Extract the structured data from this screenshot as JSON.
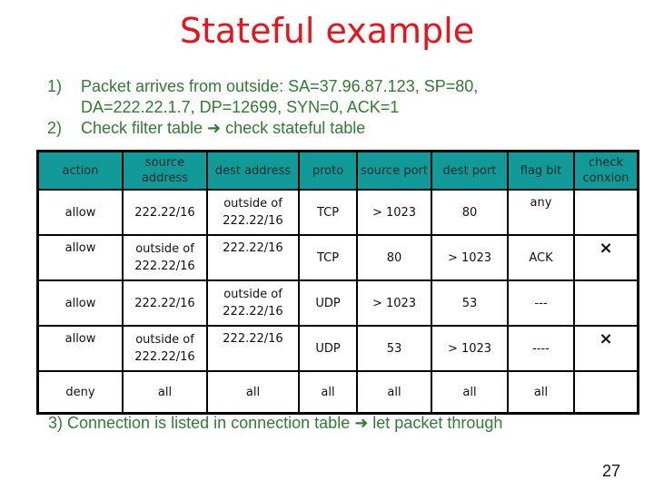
{
  "title": "Stateful example",
  "steps": [
    {
      "num": "1)",
      "text": "Packet arrives from outside: SA=37.96.87.123, SP=80,",
      "cont": "DA=222.22.1.7, DP=12699, SYN=0, ACK=1"
    },
    {
      "num": "2)",
      "text": "Check filter table ➜ check stateful table"
    }
  ],
  "table": {
    "headers": [
      "action",
      "source address",
      "dest address",
      "proto",
      "source port",
      "dest port",
      "flag bit",
      "check conxion"
    ],
    "rows": [
      [
        "allow",
        "222.22/16",
        "outside of 222.22/16",
        "TCP",
        "> 1023",
        "80",
        "any",
        ""
      ],
      [
        "allow",
        "outside of 222.22/16",
        "222.22/16",
        "TCP",
        "80",
        "> 1023",
        "ACK",
        "×"
      ],
      [
        "allow",
        "222.22/16",
        "outside of 222.22/16",
        "UDP",
        "> 1023",
        "53",
        "---",
        ""
      ],
      [
        "allow",
        "outside of 222.22/16",
        "222.22/16",
        "UDP",
        "53",
        "> 1023",
        "----",
        "×"
      ],
      [
        "deny",
        "all",
        "all",
        "all",
        "all",
        "all",
        "all",
        ""
      ]
    ]
  },
  "footer": "3) Connection is listed in connection table ➜ let packet through",
  "page_number": "27",
  "colors": {
    "title": "#e8141c",
    "text": "#2e7d32",
    "header_bg": "#129a98"
  }
}
